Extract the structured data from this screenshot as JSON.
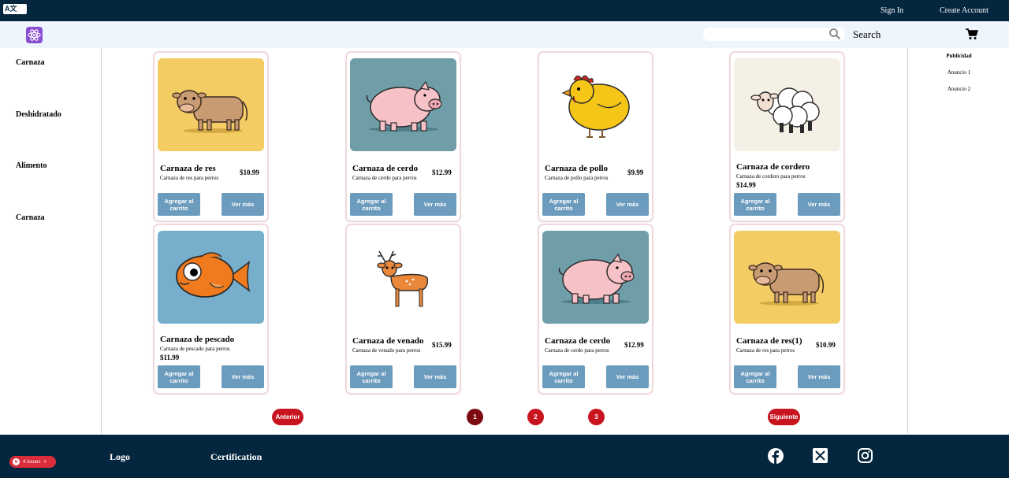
{
  "topbar": {
    "translate_label": "A文",
    "sign_in": "Sign In",
    "create_account": "Create Account"
  },
  "navbar": {
    "search_value": "",
    "search_label": "Search",
    "colors": {
      "background": "#eef5fc",
      "logo": "#8a4fd0"
    }
  },
  "sidebar": {
    "categories": [
      "Carnaza",
      "Deshidratado",
      "Alimento",
      "Carnaza"
    ]
  },
  "ads": {
    "title": "Publicidad",
    "items": [
      "Anuncio 1",
      "Anuncio 2"
    ]
  },
  "products": [
    {
      "name": "Carnaza de res",
      "desc": "Carnaza de res para perros",
      "price": "$10.99",
      "animal": "cow-icon",
      "bg": "#f4cc64"
    },
    {
      "name": "Carnaza de cerdo",
      "desc": "Carnaza de cerdo para perros",
      "price": "$12.99",
      "animal": "pig-icon",
      "bg": "#6f9ea9"
    },
    {
      "name": "Carnaza de pollo",
      "desc": "Carnaza de pollo para perros",
      "price": "$9.99",
      "animal": "chicken-icon",
      "bg": "#ffffff"
    },
    {
      "name": "Carnaza de cordero",
      "desc": "Carnaza de cordero para perros",
      "price": "$14.99",
      "animal": "sheep-icon",
      "bg": "#f4f0e6"
    },
    {
      "name": "Carnaza de pescado",
      "desc": "Carnaza de pescado para perros",
      "price": "$11.99",
      "animal": "fish-icon",
      "bg": "#77aecb"
    },
    {
      "name": "Carnaza de venado",
      "desc": "Carnaza de venado para perros",
      "price": "$15.99",
      "animal": "deer-icon",
      "bg": "#ffffff"
    },
    {
      "name": "Carnaza de cerdo",
      "desc": "Carnaza de cerdo para perros",
      "price": "$12.99",
      "animal": "pig-icon",
      "bg": "#6f9ea9"
    },
    {
      "name": "Carnaza de res(1)",
      "desc": "Carnaza de res para perros",
      "price": "$10.99",
      "animal": "cow-icon",
      "bg": "#f4cc64"
    }
  ],
  "buttons": {
    "add_to_cart": "Agregar al carrito",
    "see_more": "Ver más",
    "color": "#6b9bbd"
  },
  "pagination": {
    "prev": "Anterior",
    "pages": [
      "1",
      "2",
      "3"
    ],
    "current": "1",
    "next": "Siguiente",
    "color": "#c8141f"
  },
  "footer": {
    "logo": "Logo",
    "certification": "Certification",
    "social": [
      "facebook-icon",
      "x-icon",
      "instagram-icon"
    ],
    "issues_badge": "4 Issues",
    "issues_letter": "N",
    "background": "#04263f"
  }
}
